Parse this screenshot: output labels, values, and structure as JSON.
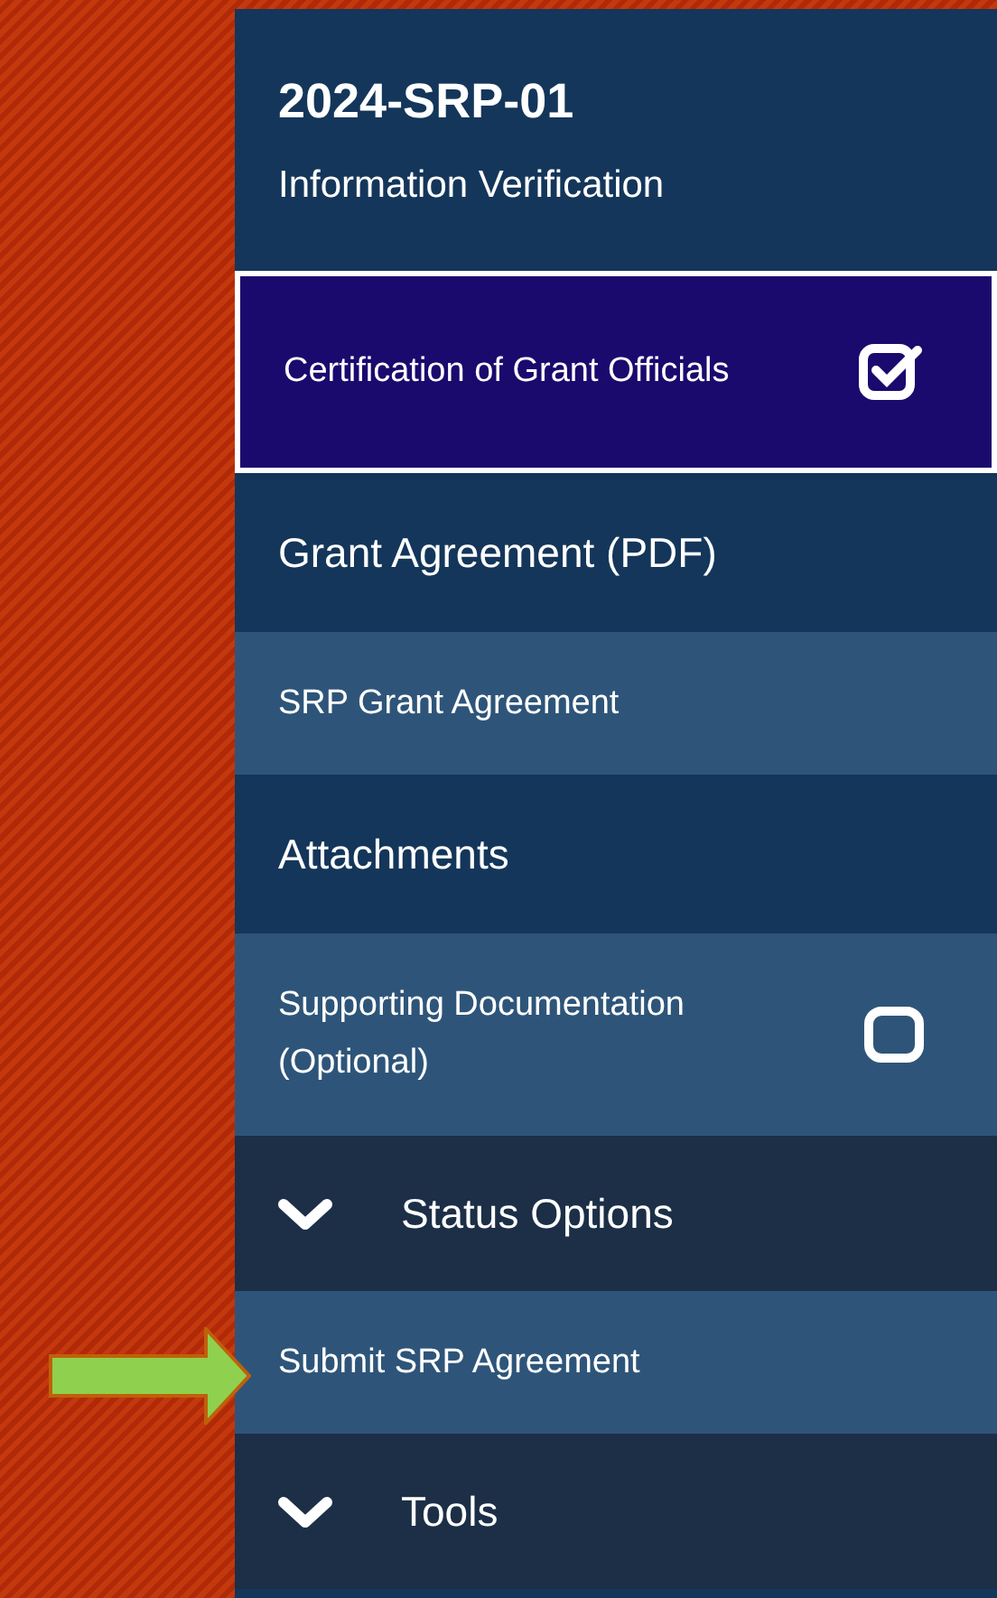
{
  "header": {
    "title": "2024-SRP-01",
    "subtitle": "Information Verification"
  },
  "sections": [
    {
      "kind": "check_item",
      "label": "Certification of Grant Officials",
      "selected": true,
      "checked": true
    },
    {
      "kind": "heading",
      "label": "Grant Agreement (PDF)"
    },
    {
      "kind": "link_item",
      "label": "SRP Grant Agreement",
      "selected": false
    },
    {
      "kind": "heading",
      "label": "Attachments"
    },
    {
      "kind": "check_item",
      "label": "Supporting Documentation (Optional)",
      "selected": false,
      "checked": false
    },
    {
      "kind": "group",
      "label": "Status Options",
      "expanded": true
    },
    {
      "kind": "link_item",
      "label": "Submit SRP Agreement",
      "selected": false
    },
    {
      "kind": "group",
      "label": "Tools",
      "expanded": true
    }
  ]
}
